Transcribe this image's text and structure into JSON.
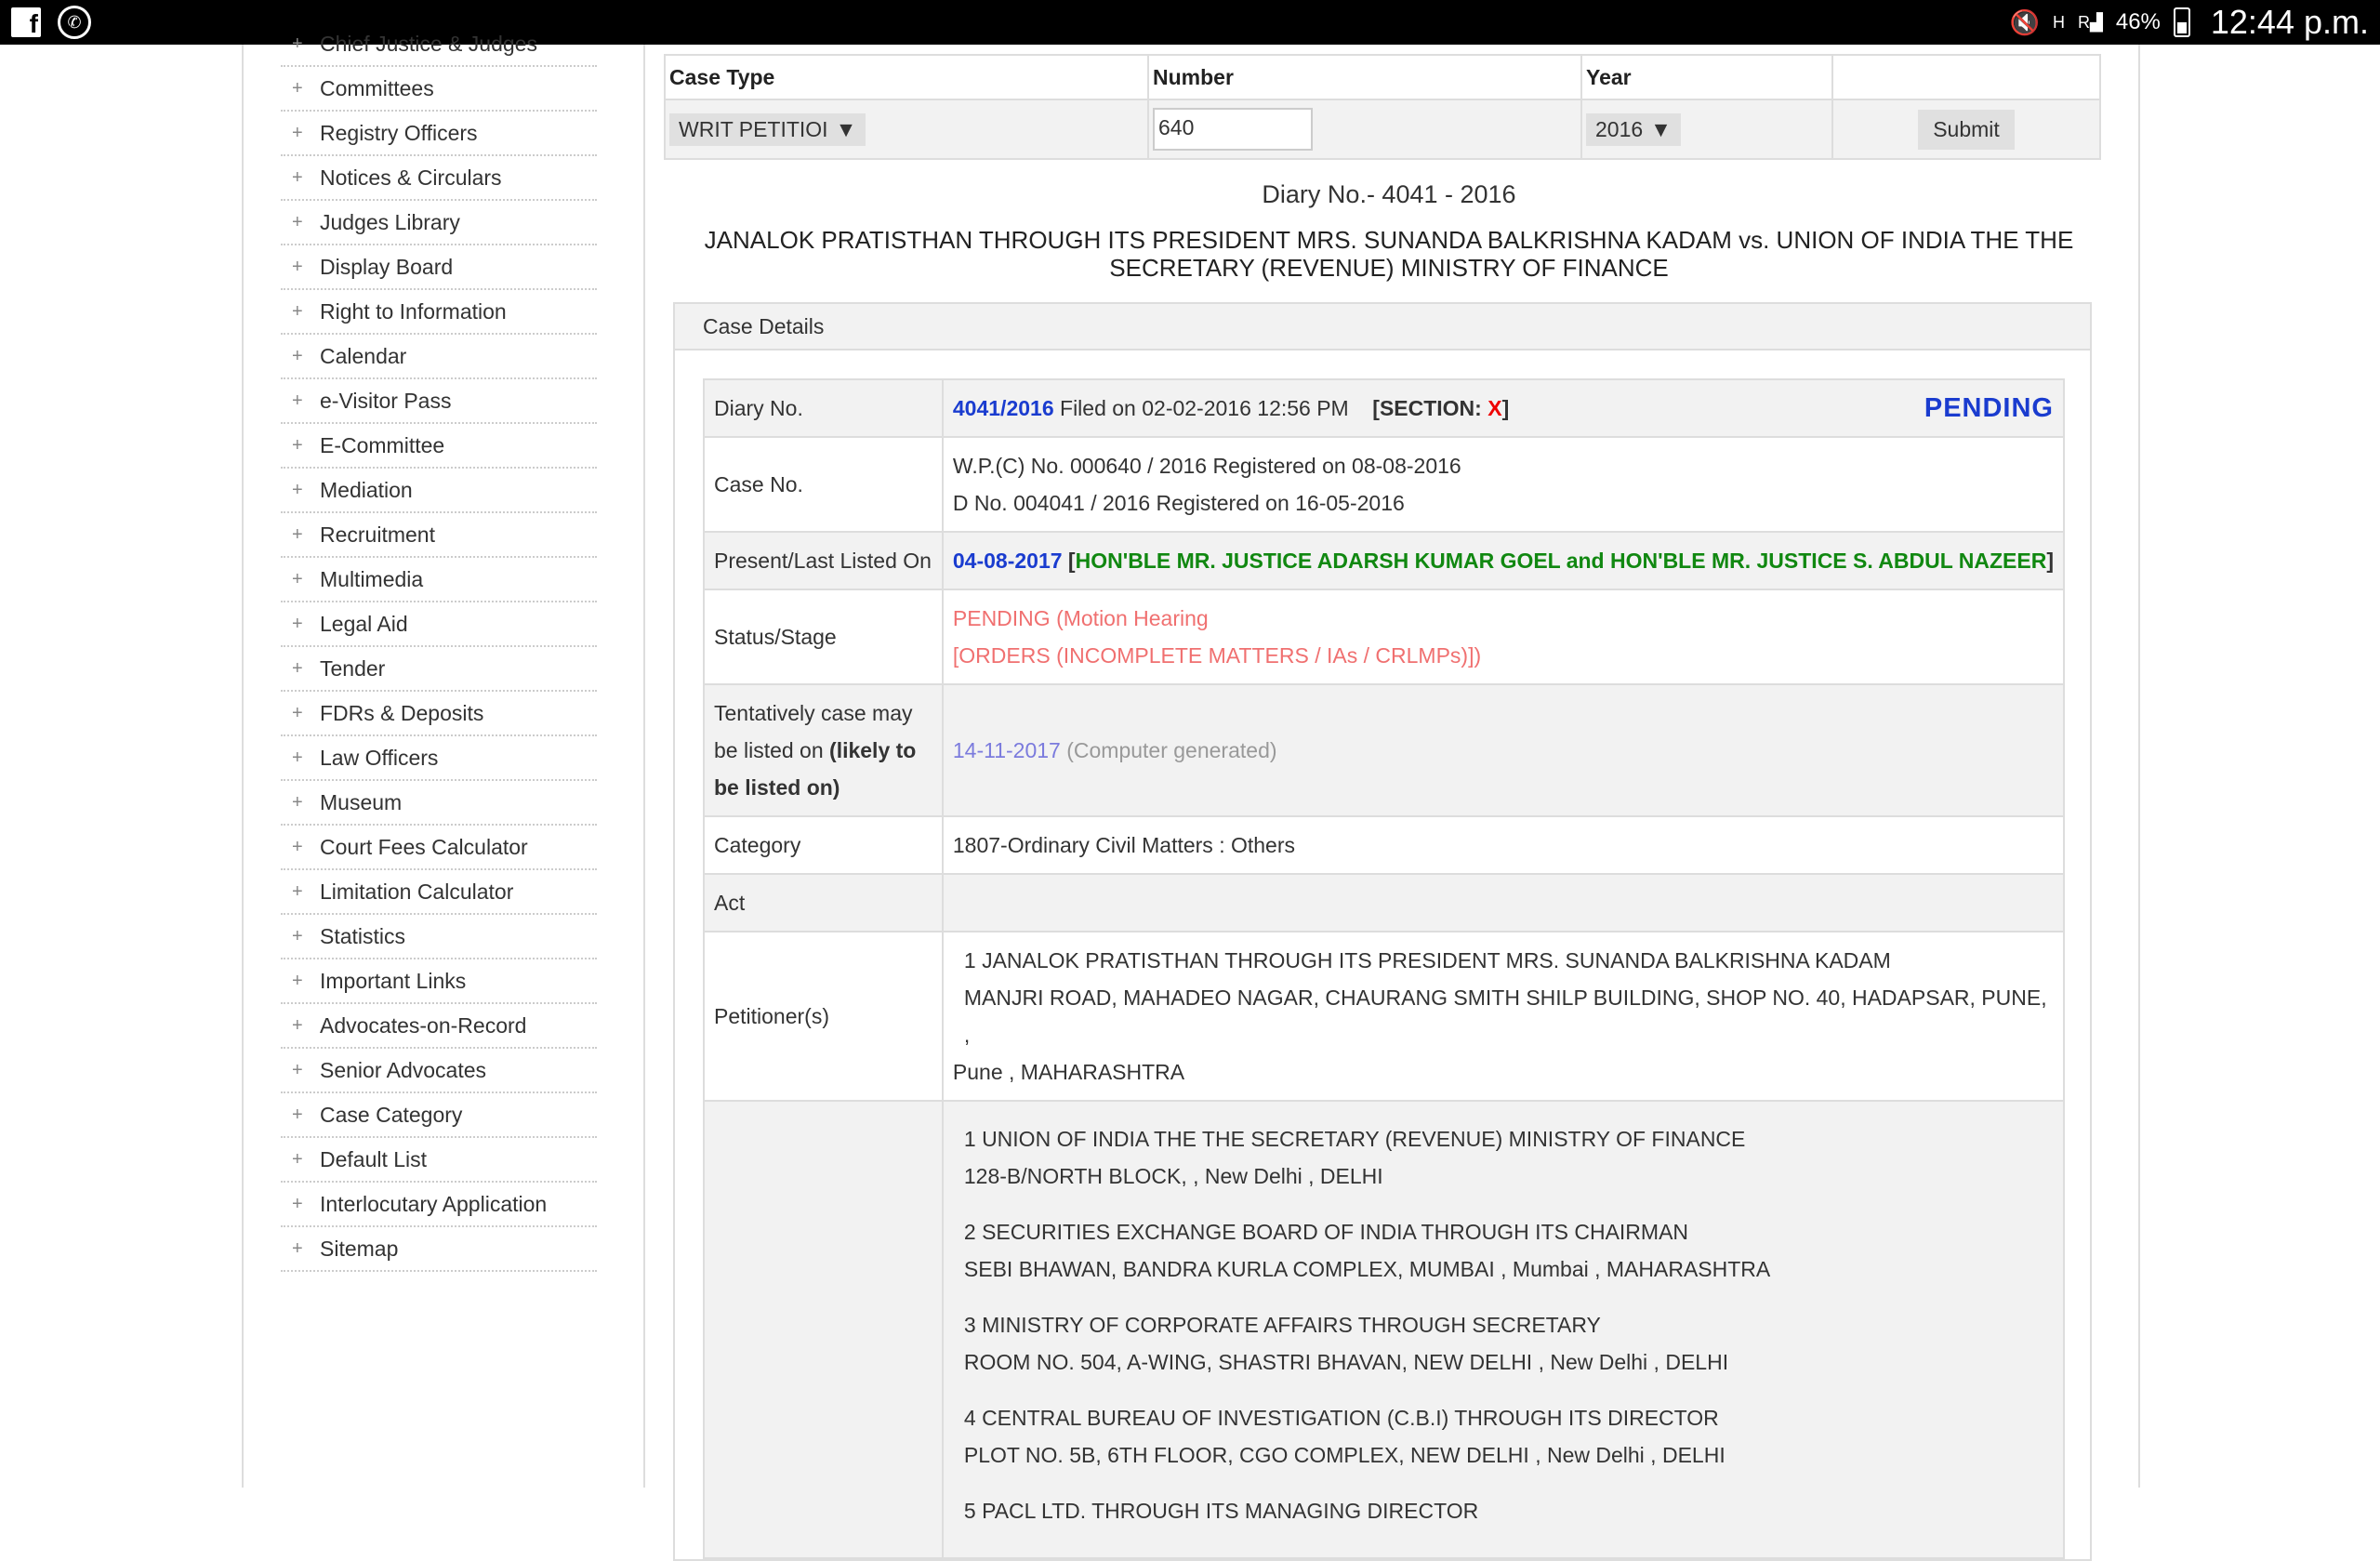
{
  "statusbar": {
    "battery": "46%",
    "time": "12:44 p.m.",
    "left_icons": [
      "facebook-icon",
      "whatsapp-icon"
    ],
    "right_icons": [
      "mute-icon",
      "hplus-icon",
      "signal-icon",
      "battery-icon"
    ],
    "network_h": "H",
    "network_r": "R"
  },
  "sidebar": {
    "items": [
      "Chief Justice & Judges",
      "Committees",
      "Registry Officers",
      "Notices & Circulars",
      "Judges Library",
      "Display Board",
      "Right to Information",
      "Calendar",
      "e-Visitor Pass",
      "E-Committee",
      "Mediation",
      "Recruitment",
      "Multimedia",
      "Legal Aid",
      "Tender",
      "FDRs & Deposits",
      "Law Officers",
      "Museum",
      "Court Fees Calculator",
      "Limitation Calculator",
      "Statistics",
      "Important Links",
      "Advocates-on-Record",
      "Senior Advocates",
      "Case Category",
      "Default List",
      "Interlocutary Application",
      "Sitemap"
    ]
  },
  "search": {
    "case_type_header": "Case Type",
    "number_header": "Number",
    "year_header": "Year",
    "case_type_value": "WRIT PETITIOI",
    "number_value": "640",
    "year_value": "2016",
    "submit_label": "Submit"
  },
  "case": {
    "diary_heading": "Diary No.- 4041 - 2016",
    "title_line1": "JANALOK PRATISTHAN THROUGH ITS PRESIDENT MRS. SUNANDA BALKRISHNA KADAM vs. UNION OF INDIA THE THE",
    "title_line2": "SECRETARY (REVENUE) MINISTRY OF FINANCE",
    "panel_title": "Case Details",
    "rows": {
      "diary_label": "Diary No.",
      "diary_no": "4041/2016",
      "filed_on": " Filed on 02-02-2016 12:56 PM",
      "section_label": "[SECTION: ",
      "section_value": "X",
      "section_close": "]",
      "status_badge": "PENDING",
      "caseno_label": "Case No.",
      "caseno_line1": "W.P.(C) No. 000640 / 2016  Registered on 08-08-2016",
      "caseno_line2": "D No. 004041 / 2016  Registered on 16-05-2016",
      "listed_label": "Present/Last Listed On",
      "listed_date": "04-08-2017",
      "listed_bench_open": " [",
      "listed_bench": "HON'BLE MR. JUSTICE ADARSH KUMAR GOEL and HON'BLE MR. JUSTICE S. ABDUL NAZEER",
      "listed_bench_close": "]",
      "status_label": "Status/Stage",
      "status_line1": "PENDING (Motion Hearing",
      "status_line2": "[ORDERS (INCOMPLETE MATTERS / IAs / CRLMPs)])",
      "tentative_label_a": "Tentatively case may be listed on ",
      "tentative_label_b": "(likely to be listed on)",
      "tentative_date": "14-11-2017",
      "tentative_note": " (Computer generated)",
      "category_label": "Category",
      "category_value": "1807-Ordinary Civil Matters : Others",
      "act_label": "Act",
      "act_value": "",
      "petitioner_label": "Petitioner(s)",
      "petitioner_line1": "1 JANALOK PRATISTHAN THROUGH ITS PRESIDENT MRS. SUNANDA BALKRISHNA KADAM",
      "petitioner_line2": "MANJRI ROAD, MAHADEO NAGAR, CHAURANG SMITH SHILP BUILDING, SHOP NO. 40, HADAPSAR, PUNE, ,",
      "petitioner_line3": "Pune , MAHARASHTRA",
      "respondent_label": "",
      "respondents": [
        {
          "name": "1 UNION OF INDIA THE THE SECRETARY (REVENUE) MINISTRY OF FINANCE",
          "addr": "128-B/NORTH BLOCK, , New Delhi , DELHI"
        },
        {
          "name": "2 SECURITIES EXCHANGE BOARD OF INDIA THROUGH ITS CHAIRMAN",
          "addr": "SEBI BHAWAN, BANDRA KURLA COMPLEX, MUMBAI , Mumbai , MAHARASHTRA"
        },
        {
          "name": "3 MINISTRY OF CORPORATE AFFAIRS THROUGH SECRETARY",
          "addr": "ROOM NO. 504, A-WING, SHASTRI BHAVAN, NEW DELHI , New Delhi , DELHI"
        },
        {
          "name": "4 CENTRAL BUREAU OF INVESTIGATION (C.B.I) THROUGH ITS DIRECTOR",
          "addr": "PLOT NO. 5B, 6TH FLOOR, CGO COMPLEX, NEW DELHI , New Delhi , DELHI"
        },
        {
          "name": "5 PACL LTD. THROUGH ITS MANAGING DIRECTOR",
          "addr": ""
        }
      ]
    }
  },
  "colors": {
    "pending": "#1a3ccf",
    "bench": "#118811",
    "status": "#f07070",
    "section": "#e00000"
  }
}
